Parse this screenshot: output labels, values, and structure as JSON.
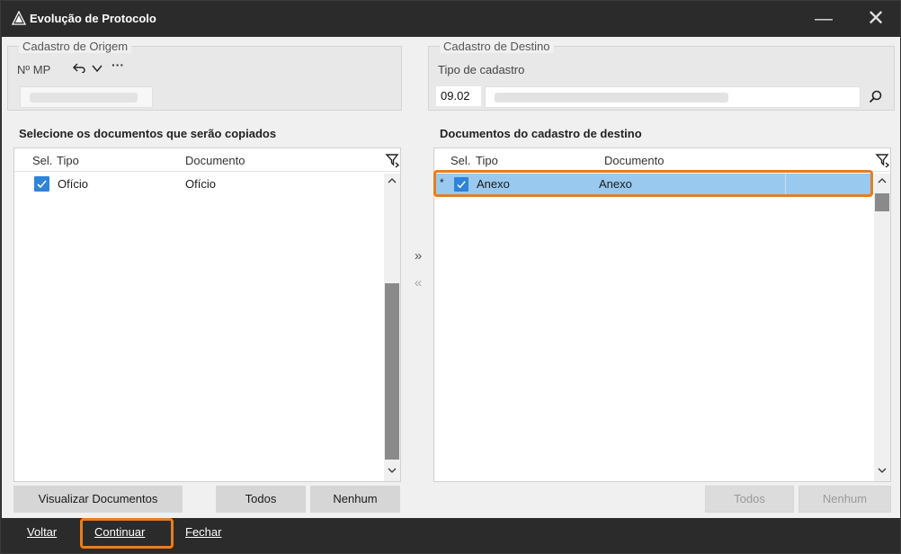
{
  "window": {
    "title": "Evolução de  Protocolo",
    "minimize_glyph": "—",
    "close_glyph": "✕"
  },
  "origem": {
    "legend": "Cadastro de Origem",
    "mp_label": "Nº MP",
    "undo_icon": "undo-icon",
    "more_glyph": "···"
  },
  "destino": {
    "legend": "Cadastro de Destino",
    "tipo_label": "Tipo de cadastro",
    "tipo_code": "09.02"
  },
  "left_panel": {
    "title": "Selecione os documentos que serão copiados",
    "columns": {
      "sel": "Sel.",
      "tipo": "Tipo",
      "documento": "Documento"
    },
    "rows": [
      {
        "checked": true,
        "tipo": "Ofício",
        "documento": "Ofício"
      }
    ],
    "buttons": {
      "visualizar": "Visualizar Documentos",
      "todos": "Todos",
      "nenhum": "Nenhum"
    }
  },
  "right_panel": {
    "title": "Documentos do cadastro de destino",
    "columns": {
      "sel": "Sel.",
      "tipo": "Tipo",
      "documento": "Documento"
    },
    "rows": [
      {
        "marker": "*",
        "checked": true,
        "tipo": "Anexo",
        "documento": "Anexo"
      }
    ],
    "buttons": {
      "todos": "Todos",
      "nenhum": "Nenhum"
    }
  },
  "move": {
    "right_glyph": "»",
    "left_glyph": "«"
  },
  "bottom": {
    "voltar": "Voltar",
    "continuar": "Continuar",
    "fechar": "Fechar"
  },
  "colors": {
    "accent": "#e67e22",
    "selection": "#99c9ef",
    "checkbox": "#2f83d8",
    "titlebar": "#2b2b2b"
  }
}
